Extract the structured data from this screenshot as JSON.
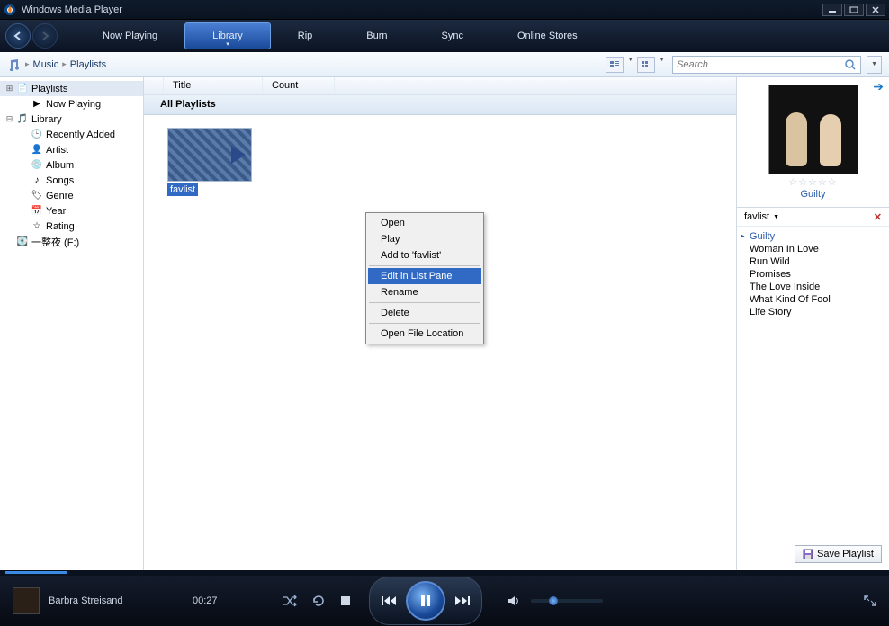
{
  "title": "Windows Media Player",
  "nav": {
    "back": "‹",
    "forward": "›"
  },
  "tabs": [
    {
      "label": "Now Playing",
      "active": false
    },
    {
      "label": "Library",
      "active": true
    },
    {
      "label": "Rip",
      "active": false
    },
    {
      "label": "Burn",
      "active": false
    },
    {
      "label": "Sync",
      "active": false
    },
    {
      "label": "Online Stores",
      "active": false
    }
  ],
  "breadcrumb": [
    "Music",
    "Playlists"
  ],
  "search": {
    "placeholder": "Search"
  },
  "tree": [
    {
      "indent": 0,
      "exp": "⊞",
      "icon": "playlist",
      "label": "Playlists",
      "sel": true
    },
    {
      "indent": 1,
      "exp": "",
      "icon": "play",
      "label": "Now Playing"
    },
    {
      "indent": 0,
      "exp": "⊟",
      "icon": "music",
      "label": "Library"
    },
    {
      "indent": 1,
      "exp": "",
      "icon": "recent",
      "label": "Recently Added"
    },
    {
      "indent": 1,
      "exp": "",
      "icon": "artist",
      "label": "Artist"
    },
    {
      "indent": 1,
      "exp": "",
      "icon": "album",
      "label": "Album"
    },
    {
      "indent": 1,
      "exp": "",
      "icon": "songs",
      "label": "Songs"
    },
    {
      "indent": 1,
      "exp": "",
      "icon": "genre",
      "label": "Genre"
    },
    {
      "indent": 1,
      "exp": "",
      "icon": "year",
      "label": "Year"
    },
    {
      "indent": 1,
      "exp": "",
      "icon": "rating",
      "label": "Rating"
    },
    {
      "indent": 0,
      "exp": "",
      "icon": "disc",
      "label": "一整夜 (F:)"
    }
  ],
  "columns": [
    "Title",
    "Count"
  ],
  "listHeader": "All Playlists",
  "tile": {
    "label": "favlist"
  },
  "contextMenu": [
    {
      "label": "Open",
      "sep": false,
      "hl": false
    },
    {
      "label": "Play",
      "sep": false,
      "hl": false
    },
    {
      "label": "Add to 'favlist'",
      "sep": false,
      "hl": false
    },
    {
      "sep": true
    },
    {
      "label": "Edit in List Pane",
      "sep": false,
      "hl": true
    },
    {
      "label": "Rename",
      "sep": false,
      "hl": false
    },
    {
      "sep": true
    },
    {
      "label": "Delete",
      "sep": false,
      "hl": false
    },
    {
      "sep": true
    },
    {
      "label": "Open File Location",
      "sep": false,
      "hl": false
    }
  ],
  "album": {
    "name": "Guilty",
    "stars": "☆☆☆☆☆"
  },
  "playlist": {
    "name": "favlist",
    "tracks": [
      {
        "title": "Guilty",
        "now": true
      },
      {
        "title": "Woman In Love"
      },
      {
        "title": "Run Wild"
      },
      {
        "title": "Promises"
      },
      {
        "title": "The Love Inside"
      },
      {
        "title": "What Kind Of Fool"
      },
      {
        "title": "Life Story"
      }
    ]
  },
  "saveBtn": "Save Playlist",
  "player": {
    "artist": "Barbra Streisand",
    "time": "00:27"
  }
}
